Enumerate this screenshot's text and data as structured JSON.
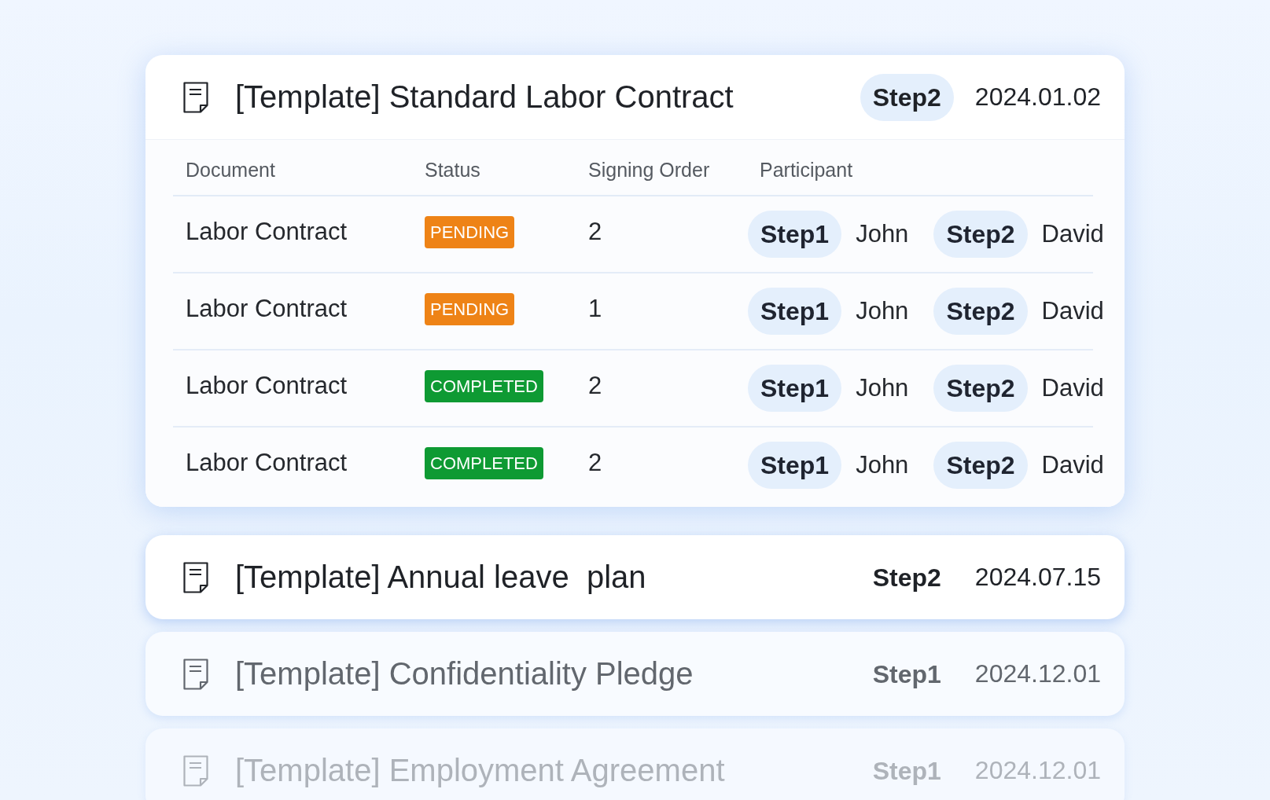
{
  "documents": [
    {
      "title": "[Template] Standard Labor Contract",
      "step": "Step2",
      "date": "2024.01.02",
      "expanded": true,
      "kind": "normal",
      "table": {
        "columns": [
          "Document",
          "Status",
          "Signing Order",
          "Participant"
        ],
        "rows": [
          {
            "document": "Labor Contract",
            "status": {
              "label": "PENDING",
              "color": "#ee8316"
            },
            "signing_order": "2",
            "participants": [
              {
                "step": "Step1",
                "name": "John"
              },
              {
                "step": "Step2",
                "name": "David"
              }
            ]
          },
          {
            "document": "Labor Contract",
            "status": {
              "label": "PENDING",
              "color": "#ee8316"
            },
            "signing_order": "1",
            "participants": [
              {
                "step": "Step1",
                "name": "John"
              },
              {
                "step": "Step2",
                "name": "David"
              }
            ]
          },
          {
            "document": "Labor Contract",
            "status": {
              "label": "COMPLETED",
              "color": "#0e9a33"
            },
            "signing_order": "2",
            "participants": [
              {
                "step": "Step1",
                "name": "John"
              },
              {
                "step": "Step2",
                "name": "David"
              }
            ]
          },
          {
            "document": "Labor Contract",
            "status": {
              "label": "COMPLETED",
              "color": "#0e9a33"
            },
            "signing_order": "2",
            "participants": [
              {
                "step": "Step1",
                "name": "John"
              },
              {
                "step": "Step2",
                "name": "David"
              }
            ]
          }
        ]
      }
    },
    {
      "title": "[Template] Annual leave  plan",
      "step": "Step2",
      "date": "2024.07.15",
      "expanded": false,
      "kind": "normal"
    },
    {
      "title": "[Template] Confidentiality Pledge",
      "step": "Step1",
      "date": "2024.12.01",
      "expanded": false,
      "kind": "muted"
    },
    {
      "title": "[Template] Employment Agreement",
      "step": "Step1",
      "date": "2024.12.01",
      "expanded": false,
      "kind": "faint"
    }
  ]
}
